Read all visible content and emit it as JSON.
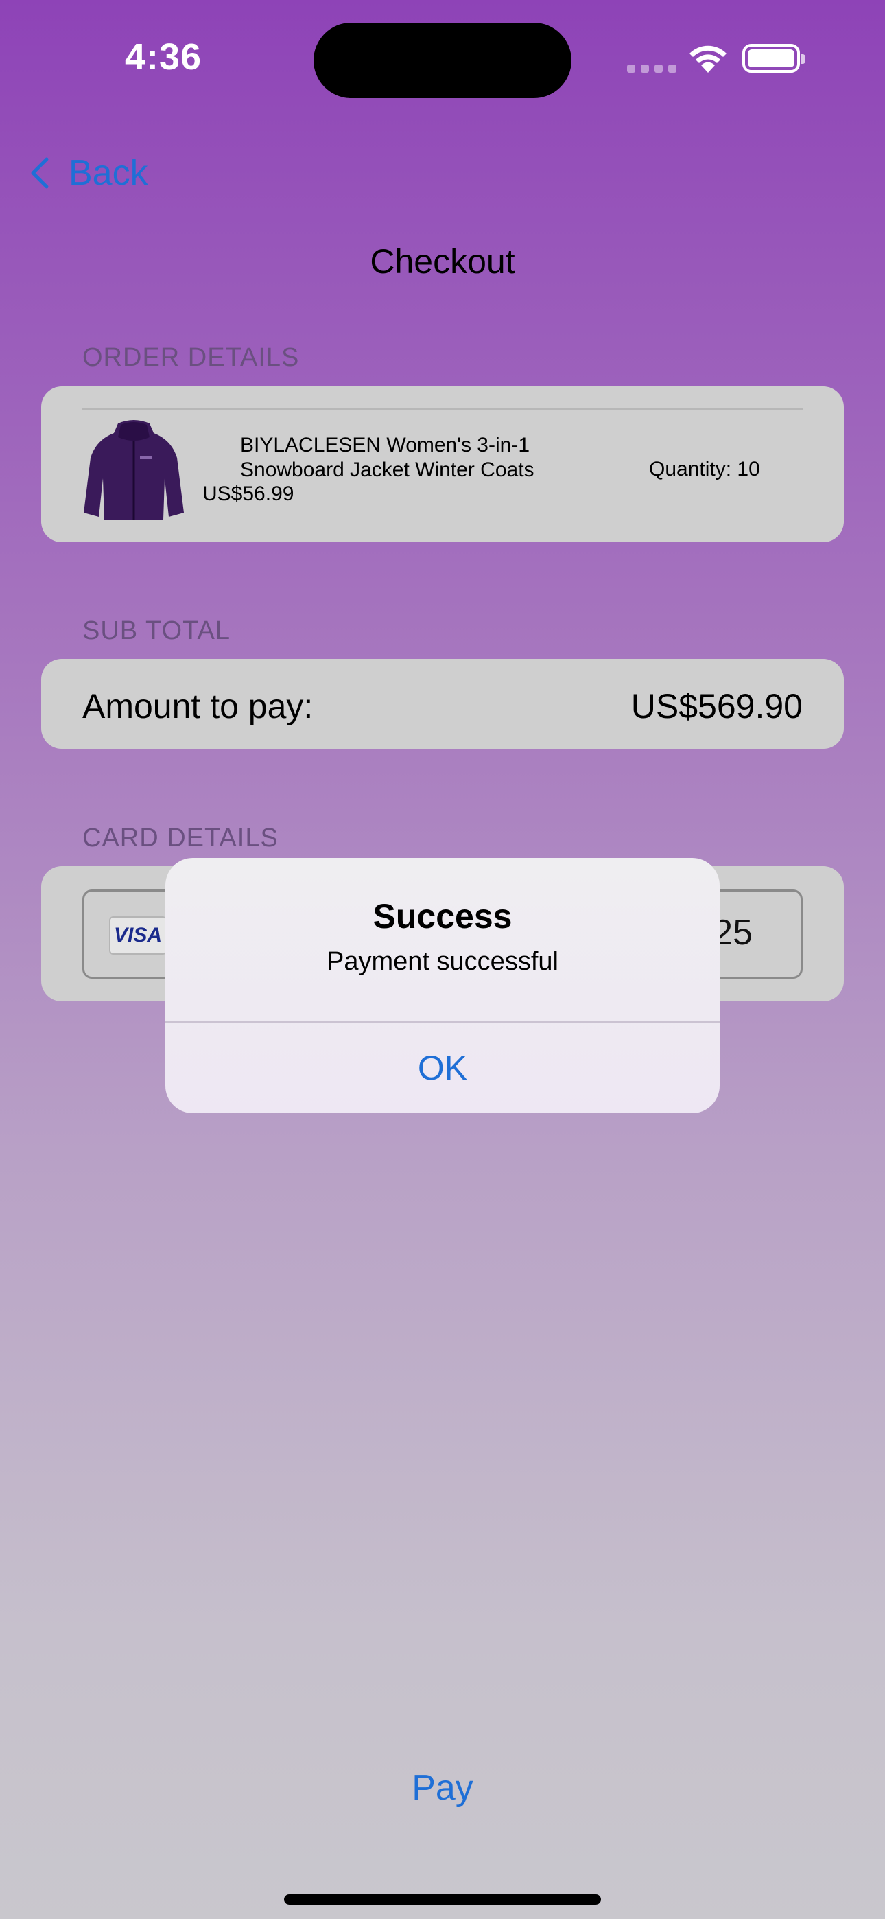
{
  "status_bar": {
    "time": "4:36"
  },
  "nav": {
    "back_label": "Back",
    "title": "Checkout"
  },
  "order_details": {
    "section_label": "ORDER DETAILS",
    "product_name": "BIYLACLESEN Women's 3-in-1 Snowboard Jacket Winter Coats",
    "price": "US$56.99",
    "quantity": "Quantity: 10"
  },
  "sub_total": {
    "section_label": "SUB TOTAL",
    "amount_label": "Amount to pay:",
    "amount_value": "US$569.90"
  },
  "card_details": {
    "section_label": "CARD DETAILS",
    "brand": "VISA",
    "field_tail": "25"
  },
  "alert": {
    "title": "Success",
    "message": "Payment successful",
    "ok_label": "OK"
  },
  "footer": {
    "pay_label": "Pay"
  },
  "colors": {
    "accent": "#1f6fd6",
    "card_bg": "#cfcfcf",
    "gradient_top": "#8e43b7",
    "gradient_bottom": "#c9c7cd"
  }
}
